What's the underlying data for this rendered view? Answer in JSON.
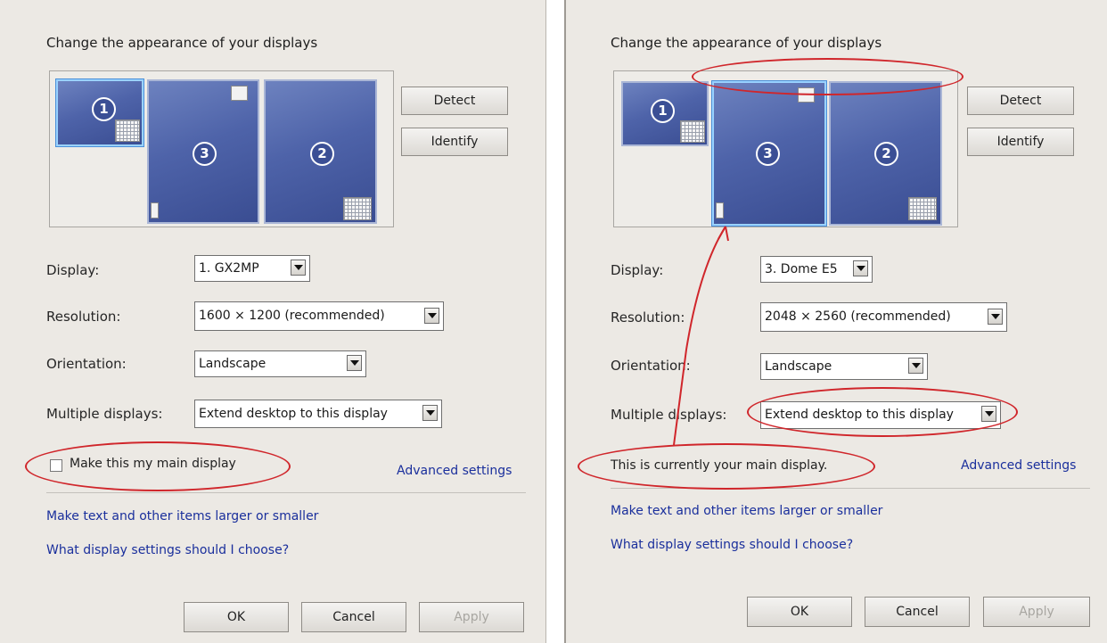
{
  "left": {
    "title": "Change the appearance of your displays",
    "detect_label": "Detect",
    "identify_label": "Identify",
    "display_label": "Display:",
    "display_value": "1. GX2MP",
    "resolution_label": "Resolution:",
    "resolution_value": "1600 × 1200 (recommended)",
    "orientation_label": "Orientation:",
    "orientation_value": "Landscape",
    "multiple_label": "Multiple displays:",
    "multiple_value": "Extend desktop to this display",
    "main_display_checkbox_label": "Make this my main display",
    "main_display_checked": false,
    "advanced_link": "Advanced settings",
    "text_size_link": "Make text and other items larger or smaller",
    "help_link": "What display settings should I choose?",
    "ok_label": "OK",
    "cancel_label": "Cancel",
    "apply_label": "Apply",
    "monitors": [
      "1",
      "3",
      "2"
    ]
  },
  "right": {
    "title": "Change the appearance of your displays",
    "detect_label": "Detect",
    "identify_label": "Identify",
    "display_label": "Display:",
    "display_value": "3. Dome E5",
    "resolution_label": "Resolution:",
    "resolution_value": "2048 × 2560 (recommended)",
    "orientation_label": "Orientation:",
    "orientation_value": "Landscape",
    "multiple_label": "Multiple displays:",
    "multiple_value": "Extend desktop to this display",
    "main_display_status": "This is currently your main display.",
    "advanced_link": "Advanced settings",
    "text_size_link": "Make text and other items larger or smaller",
    "help_link": "What display settings should I choose?",
    "ok_label": "OK",
    "cancel_label": "Cancel",
    "apply_label": "Apply",
    "monitors": [
      "1",
      "3",
      "2"
    ]
  },
  "colors": {
    "annotation": "#d0262b",
    "link": "#1a2f9c",
    "monitor": "#4e63a9",
    "panel_bg": "#ece9e4"
  }
}
